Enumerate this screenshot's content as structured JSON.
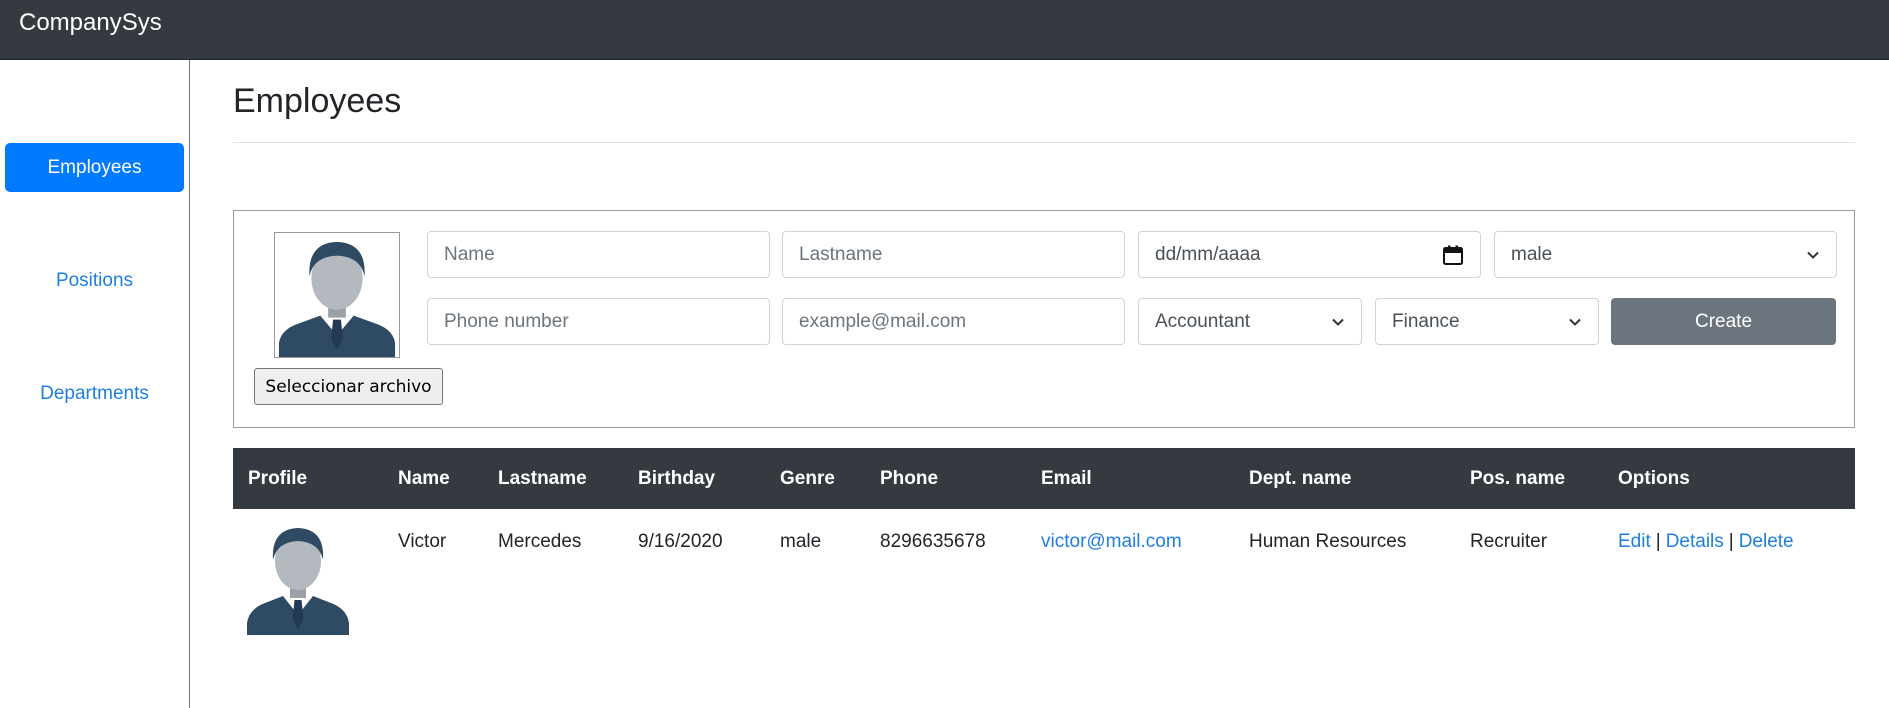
{
  "app": {
    "brand": "CompanySys"
  },
  "sidebar": {
    "items": [
      {
        "label": "Employees",
        "active": true
      },
      {
        "label": "Positions",
        "active": false
      },
      {
        "label": "Departments",
        "active": false
      }
    ]
  },
  "page": {
    "title": "Employees"
  },
  "form": {
    "file_button_label": "Seleccionar archivo",
    "name_placeholder": "Name",
    "lastname_placeholder": "Lastname",
    "birthday_placeholder": "dd/mm/aaaa",
    "genre_selected": "male",
    "phone_placeholder": "Phone number",
    "email_placeholder": "example@mail.com",
    "position_selected": "Accountant",
    "department_selected": "Finance",
    "create_label": "Create"
  },
  "table": {
    "headers": [
      "Profile",
      "Name",
      "Lastname",
      "Birthday",
      "Genre",
      "Phone",
      "Email",
      "Dept. name",
      "Pos. name",
      "Options"
    ],
    "rows": [
      {
        "name": "Victor",
        "lastname": "Mercedes",
        "birthday": "9/16/2020",
        "genre": "male",
        "phone": "8296635678",
        "email": "victor@mail.com",
        "dept": "Human Resources",
        "pos": "Recruiter",
        "options": {
          "edit": "Edit",
          "details": "Details",
          "delete": "Delete",
          "separator": "|"
        }
      }
    ]
  },
  "colors": {
    "navbar": "#343a40",
    "primary": "#007bff",
    "link": "#1e7fe0",
    "secondary_button": "#6c757d",
    "avatar_hair_suit": "#2f4a63",
    "avatar_face": "#b3b9bf"
  },
  "icons": [
    "default-avatar-icon",
    "calendar-icon",
    "chevron-down-icon"
  ]
}
